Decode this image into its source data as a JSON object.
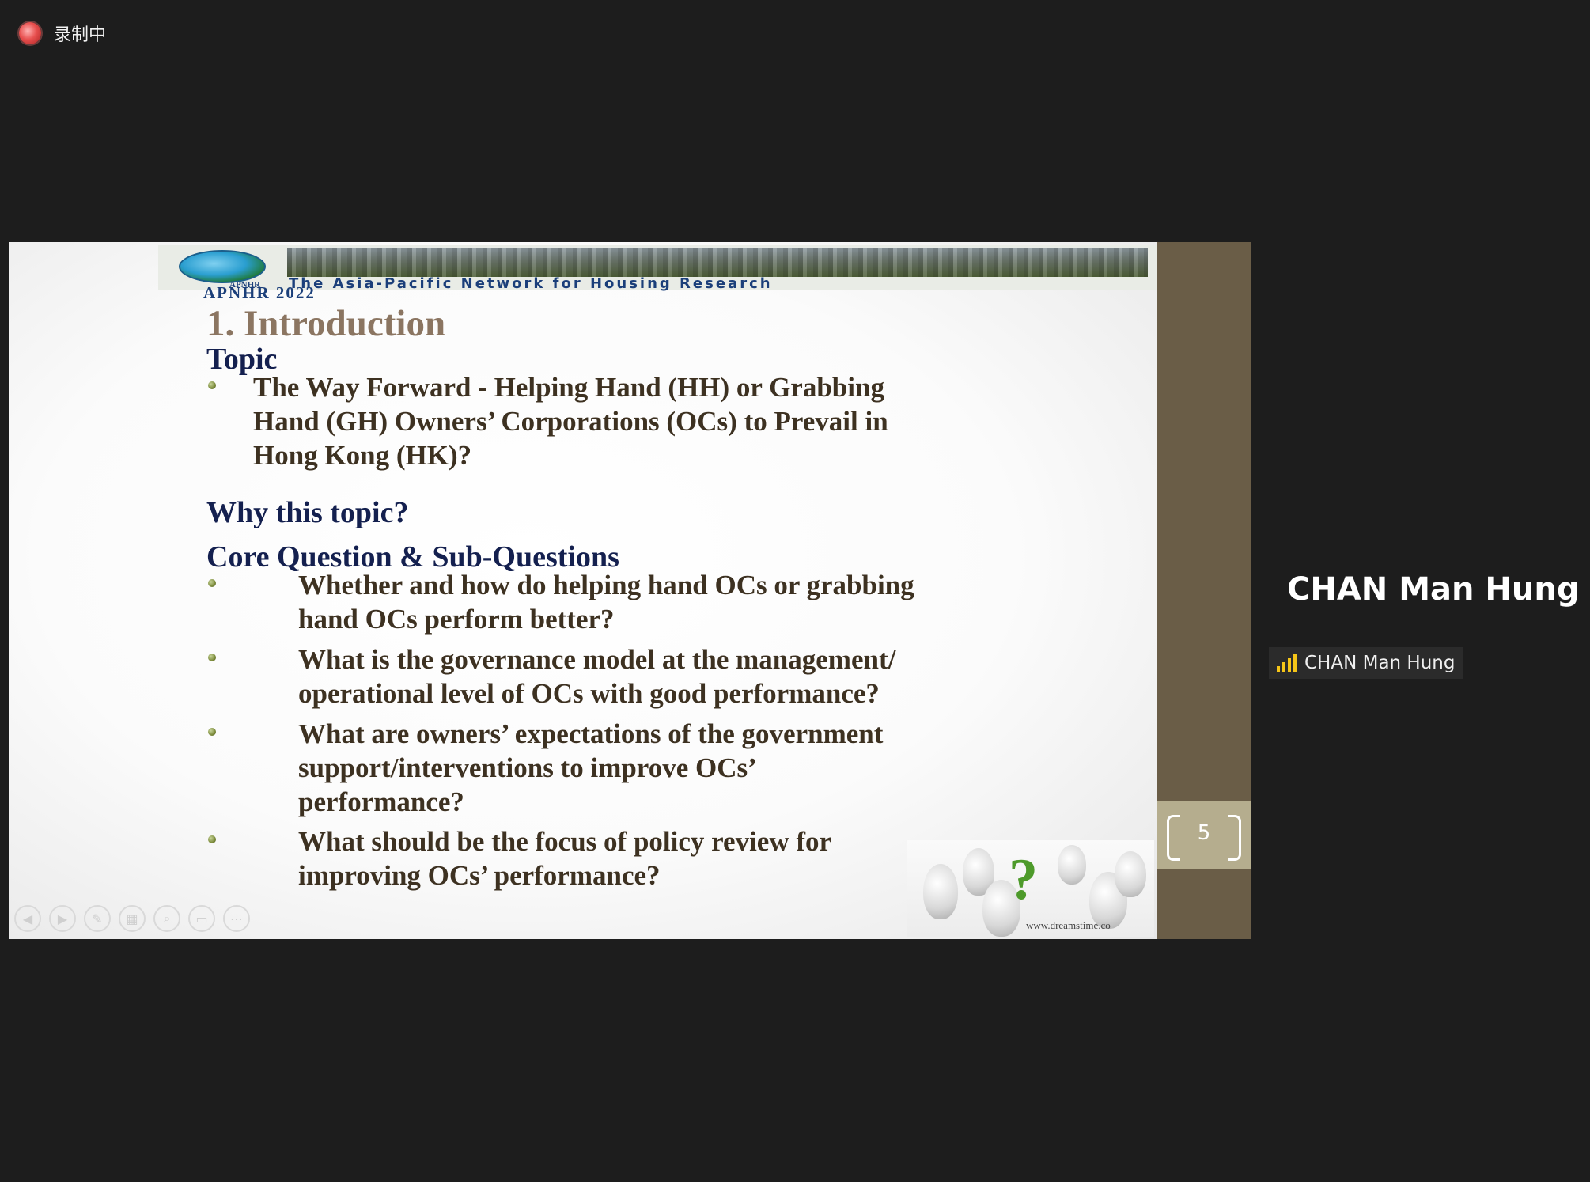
{
  "recording": {
    "label": "录制中"
  },
  "slide": {
    "header": {
      "logo_small": "APNHR",
      "network_name": "The Asia-Pacific Network for Housing Research",
      "conference": "APNHR  2022"
    },
    "title": "1. Introduction",
    "topic_heading": "Topic",
    "topic_bullet": [
      "The Way Forward - Helping Hand (HH) or Grabbing",
      "Hand (GH) Owners’ Corporations (OCs) to Prevail in",
      "Hong Kong (HK)?"
    ],
    "why_heading": "Why this topic?",
    "core_heading": "Core Question & Sub-Questions",
    "questions": [
      [
        "Whether and how do helping hand OCs or grabbing",
        "hand OCs perform better?"
      ],
      [
        "What is the governance model at the management/",
        "operational level of OCs with good performance?"
      ],
      [
        "What are owners’ expectations of the government",
        "support/interventions to improve OCs’",
        "performance?"
      ],
      [
        "What should be the focus of policy review for",
        "improving OCs’ performance?"
      ]
    ],
    "image_credit": "www.dreamstime.co",
    "controls": [
      "prev-icon",
      "next-icon",
      "pen-icon",
      "slides-icon",
      "zoom-icon",
      "subtitle-icon",
      "more-icon"
    ]
  },
  "page_number": "5",
  "speaker": {
    "display_name": "CHAN Man Hung",
    "tag_name": "CHAN Man Hung",
    "signal_color": "#f5c518"
  }
}
